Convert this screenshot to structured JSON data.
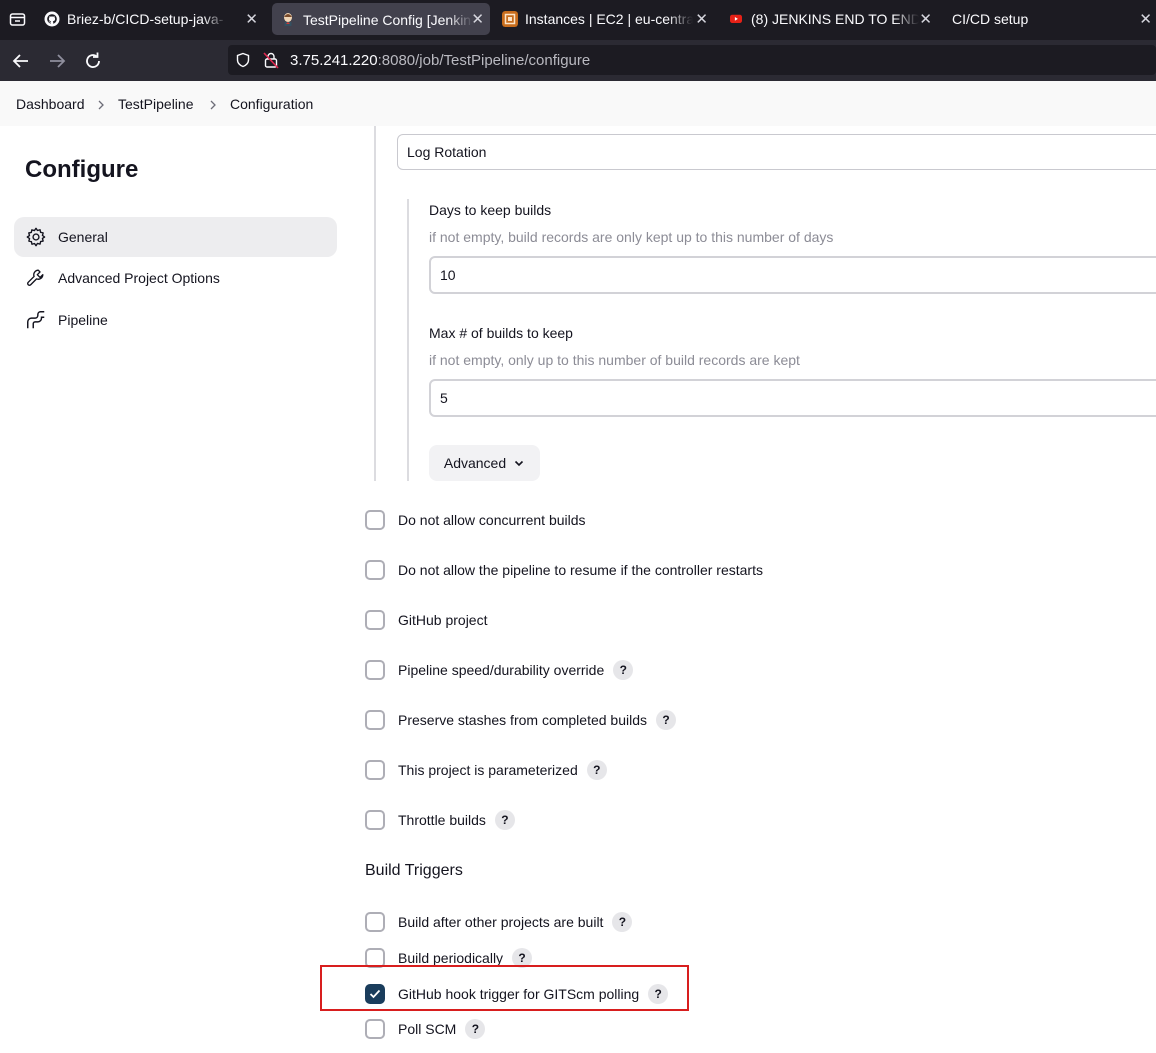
{
  "browser": {
    "tabs": [
      {
        "title": "Briez-b/CICD-setup-java-",
        "icon": "github-icon",
        "active": false
      },
      {
        "title": "TestPipeline Config [Jenkins]",
        "icon": "jenkins-icon",
        "active": true
      },
      {
        "title": "Instances | EC2 | eu-central",
        "icon": "aws-icon",
        "active": false
      },
      {
        "title": "(8) JENKINS END TO END",
        "icon": "youtube-icon",
        "active": false
      },
      {
        "title": "CI/CD setup",
        "icon": "",
        "active": false
      }
    ],
    "url_host": "3.75.241.220",
    "url_rest": ":8080/job/TestPipeline/configure"
  },
  "breadcrumb": [
    "Dashboard",
    "TestPipeline",
    "Configuration"
  ],
  "sidebar": {
    "title": "Configure",
    "items": [
      {
        "label": "General",
        "icon": "gear-icon",
        "active": true
      },
      {
        "label": "Advanced Project Options",
        "icon": "wrench-icon",
        "active": false
      },
      {
        "label": "Pipeline",
        "icon": "pipeline-icon",
        "active": false
      }
    ]
  },
  "general": {
    "strategy_value": "Log Rotation",
    "days_label": "Days to keep builds",
    "days_help": "if not empty, build records are only kept up to this number of days",
    "days_value": "10",
    "max_label": "Max # of builds to keep",
    "max_help": "if not empty, only up to this number of build records are kept",
    "max_value": "5",
    "advanced_label": "Advanced",
    "options": [
      {
        "label": "Do not allow concurrent builds",
        "checked": false,
        "help": false
      },
      {
        "label": "Do not allow the pipeline to resume if the controller restarts",
        "checked": false,
        "help": false
      },
      {
        "label": "GitHub project",
        "checked": false,
        "help": false
      },
      {
        "label": "Pipeline speed/durability override",
        "checked": false,
        "help": true
      },
      {
        "label": "Preserve stashes from completed builds",
        "checked": false,
        "help": true
      },
      {
        "label": "This project is parameterized",
        "checked": false,
        "help": true
      },
      {
        "label": "Throttle builds",
        "checked": false,
        "help": true
      }
    ]
  },
  "build_triggers": {
    "title": "Build Triggers",
    "options": [
      {
        "label": "Build after other projects are built",
        "checked": false,
        "help": true
      },
      {
        "label": "Build periodically",
        "checked": false,
        "help": true
      },
      {
        "label": "GitHub hook trigger for GITScm polling",
        "checked": true,
        "help": true
      },
      {
        "label": "Poll SCM",
        "checked": false,
        "help": true
      }
    ]
  },
  "help_glyph": "?",
  "colors": {
    "highlight": "#d81e1e",
    "checked": "#1a3d5c"
  }
}
